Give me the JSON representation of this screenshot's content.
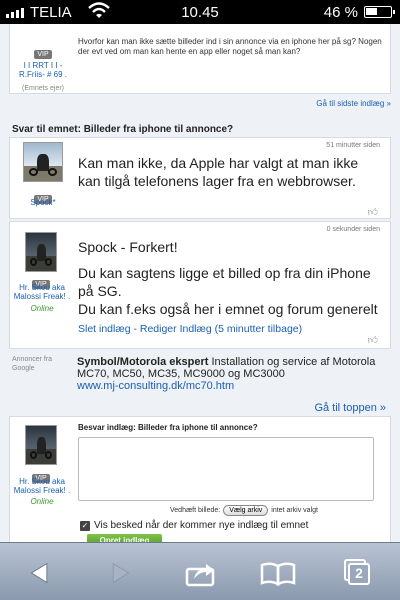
{
  "status_bar": {
    "carrier": "TELIA",
    "time": "10.45",
    "battery_percent_text": "46 %",
    "battery_level": 0.46
  },
  "top_card": {
    "question": "Hvorfor kan man ikke sætte billeder ind i sin annonce via en iphone her på sg? Nogen der evt ved om man kan hente en app eller noget så man kan?",
    "vip_badge": "VIP",
    "username": "I I RRT I I -R.Friis- # 69 .",
    "owner_label": "(Emnets ejer)",
    "last_post_link": "Gå til sidste indlæg »"
  },
  "reply_heading": "Svar til emnet: Billeder fra iphone til annonce?",
  "posts": [
    {
      "timestamp": "51 minutter siden",
      "vip_badge": "VIP",
      "username": "Spock*",
      "text": "Kan man ikke, da Apple har valgt at man ikke kan tilgå telefonens lager fra en webbrowser."
    },
    {
      "timestamp": "0 sekunder siden",
      "vip_badge": "VIP",
      "username": "Hr. Skou aka Malossi Freak! .",
      "online": "Online",
      "line1": "Spock - Forkert!",
      "line2": "Du kan sagtens ligge et billed op fra din iPhone på SG.",
      "line3": "Du kan f.eks også her i emnet og forum generelt",
      "delete_link": "Slet indlæg",
      "separator": " - ",
      "edit_link": "Rediger Indlæg (5 minutter tilbage)"
    }
  ],
  "ad": {
    "label": "Annoncer fra Google",
    "title": "Symbol/Motorola ekspert",
    "body": " Installation og service af Motorola MC70, MC50, MC35, MC9000 og MC3000",
    "url": "www.mj-consulting.dk/mc70.htm"
  },
  "go_top_link": "Gå til toppen »",
  "reply_form": {
    "vip_badge": "VIP",
    "username": "Hr. Skou aka Malossi Freak! .",
    "online": "Online",
    "title": "Besvar indlæg: Billeder fra iphone til annonce?",
    "textarea_value": "",
    "attach_label": "Vedhæft billede:",
    "choose_file_button": "Vælg arkiv",
    "no_file_text": "intet arkiv valgt",
    "notify_checked": true,
    "notify_label": "Vis besked når der kommer nye indlæg til emnet",
    "submit_button": "Opret indlæg"
  },
  "toolbar": {
    "back_icon": "back-arrow-icon",
    "forward_icon": "forward-arrow-icon",
    "share_icon": "share-icon",
    "bookmarks_icon": "bookmarks-icon",
    "pages_count": "2"
  }
}
